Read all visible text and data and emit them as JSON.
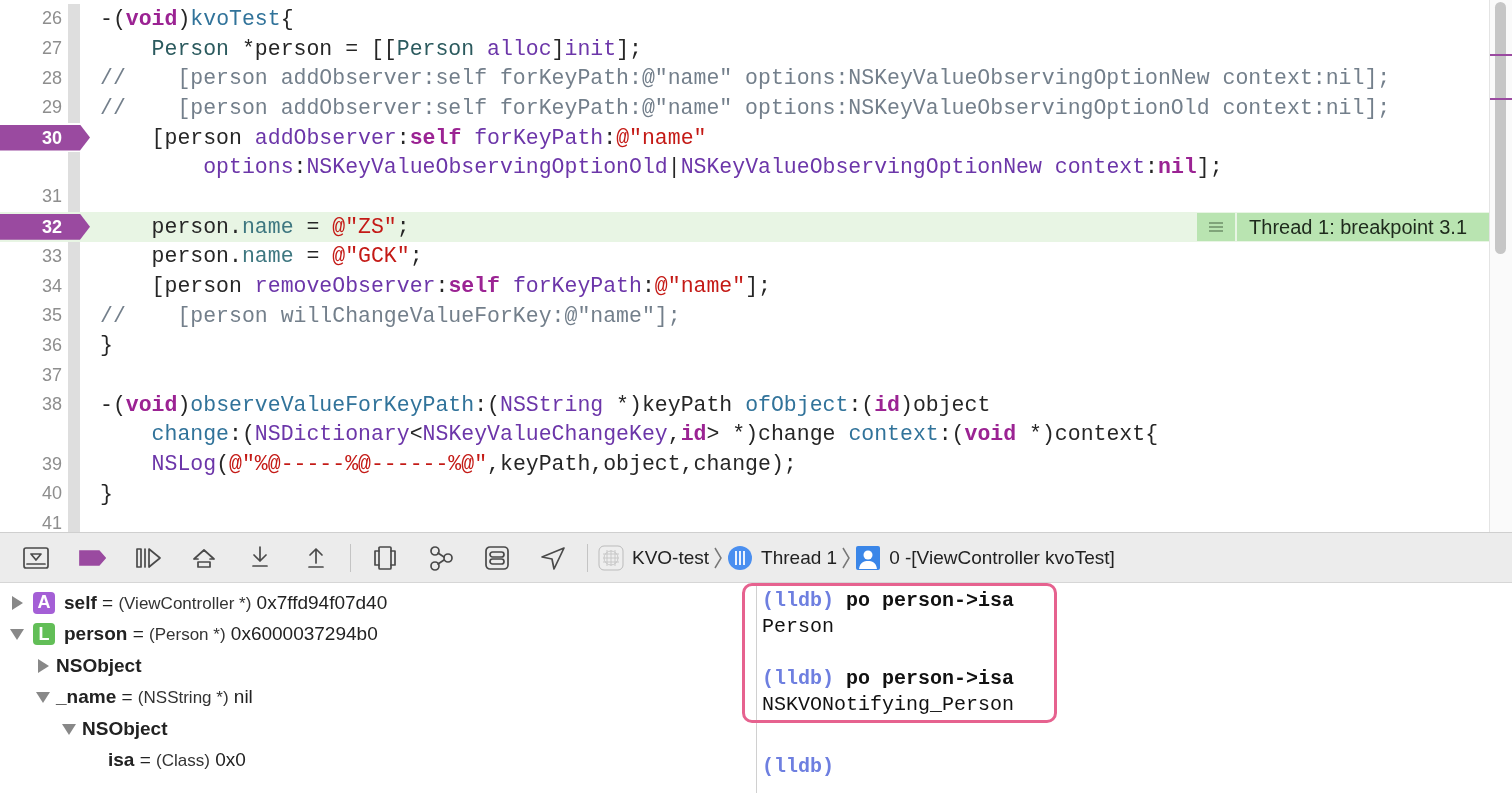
{
  "editor": {
    "lines": [
      {
        "number": "26",
        "breakpoint": false,
        "current": false,
        "segments": [
          [
            {
              "kind": "plain",
              "text": "-("
            },
            {
              "kind": "keyword",
              "text": "void"
            },
            {
              "kind": "plain",
              "text": ")"
            },
            {
              "kind": "decl",
              "text": "kvoTest"
            },
            {
              "kind": "plain",
              "text": "{"
            }
          ]
        ]
      },
      {
        "number": "27",
        "breakpoint": false,
        "current": false,
        "segments": [
          [
            {
              "kind": "type",
              "text": "    Person"
            },
            {
              "kind": "plain",
              "text": " *person = [["
            },
            {
              "kind": "type",
              "text": "Person"
            },
            {
              "kind": "api",
              "text": " alloc"
            },
            {
              "kind": "plain",
              "text": "]"
            },
            {
              "kind": "api",
              "text": "init"
            },
            {
              "kind": "plain",
              "text": "];"
            }
          ]
        ]
      },
      {
        "number": "28",
        "breakpoint": false,
        "current": false,
        "segments": [
          [
            {
              "kind": "comment",
              "text": "//    [person addObserver:self forKeyPath:@\"name\" options:NSKeyValueObservingOptionNew context:nil];"
            }
          ]
        ]
      },
      {
        "number": "29",
        "breakpoint": false,
        "current": false,
        "segments": [
          [
            {
              "kind": "comment",
              "text": "//    [person addObserver:self forKeyPath:@\"name\" options:NSKeyValueObservingOptionOld context:nil];"
            }
          ]
        ]
      },
      {
        "number": "30",
        "breakpoint": true,
        "current": false,
        "segments": [
          [
            {
              "kind": "plain",
              "text": "    [person "
            },
            {
              "kind": "api",
              "text": "addObserver"
            },
            {
              "kind": "plain",
              "text": ":"
            },
            {
              "kind": "keyword",
              "text": "self"
            },
            {
              "kind": "api",
              "text": " forKeyPath"
            },
            {
              "kind": "plain",
              "text": ":"
            },
            {
              "kind": "string",
              "text": "@\"name\""
            }
          ],
          [
            {
              "kind": "api",
              "text": "        options"
            },
            {
              "kind": "plain",
              "text": ":"
            },
            {
              "kind": "api",
              "text": "NSKeyValueObservingOptionOld"
            },
            {
              "kind": "plain",
              "text": "|"
            },
            {
              "kind": "api",
              "text": "NSKeyValueObservingOptionNew"
            },
            {
              "kind": "api",
              "text": " context"
            },
            {
              "kind": "plain",
              "text": ":"
            },
            {
              "kind": "keyword",
              "text": "nil"
            },
            {
              "kind": "plain",
              "text": "];"
            }
          ]
        ]
      },
      {
        "number": "31",
        "breakpoint": false,
        "current": false
      },
      {
        "number": "32",
        "breakpoint": true,
        "current": true,
        "annotation": "Thread 1: breakpoint 3.1",
        "segments": [
          [
            {
              "kind": "plain",
              "text": "    person."
            },
            {
              "kind": "property",
              "text": "name"
            },
            {
              "kind": "plain",
              "text": " = "
            },
            {
              "kind": "string",
              "text": "@\"ZS\""
            },
            {
              "kind": "plain",
              "text": ";"
            }
          ]
        ]
      },
      {
        "number": "33",
        "breakpoint": false,
        "current": false,
        "segments": [
          [
            {
              "kind": "plain",
              "text": "    person."
            },
            {
              "kind": "property",
              "text": "name"
            },
            {
              "kind": "plain",
              "text": " = "
            },
            {
              "kind": "string",
              "text": "@\"GCK\""
            },
            {
              "kind": "plain",
              "text": ";"
            }
          ]
        ]
      },
      {
        "number": "34",
        "breakpoint": false,
        "current": false,
        "segments": [
          [
            {
              "kind": "plain",
              "text": "    [person "
            },
            {
              "kind": "api",
              "text": "removeObserver"
            },
            {
              "kind": "plain",
              "text": ":"
            },
            {
              "kind": "keyword",
              "text": "self"
            },
            {
              "kind": "api",
              "text": " forKeyPath"
            },
            {
              "kind": "plain",
              "text": ":"
            },
            {
              "kind": "string",
              "text": "@\"name\""
            },
            {
              "kind": "plain",
              "text": "];"
            }
          ]
        ]
      },
      {
        "number": "35",
        "breakpoint": false,
        "current": false,
        "segments": [
          [
            {
              "kind": "comment",
              "text": "//    [person willChangeValueForKey:@\"name\"];"
            }
          ]
        ]
      },
      {
        "number": "36",
        "breakpoint": false,
        "current": false,
        "segments": [
          [
            {
              "kind": "plain",
              "text": "}"
            }
          ]
        ]
      },
      {
        "number": "37",
        "breakpoint": false,
        "current": false
      },
      {
        "number": "38",
        "breakpoint": false,
        "current": false,
        "segments": [
          [
            {
              "kind": "plain",
              "text": "-("
            },
            {
              "kind": "keyword",
              "text": "void"
            },
            {
              "kind": "plain",
              "text": ")"
            },
            {
              "kind": "decl",
              "text": "observeValueForKeyPath"
            },
            {
              "kind": "plain",
              "text": ":("
            },
            {
              "kind": "api",
              "text": "NSString"
            },
            {
              "kind": "plain",
              "text": " *)keyPath "
            },
            {
              "kind": "decl",
              "text": "ofObject"
            },
            {
              "kind": "plain",
              "text": ":("
            },
            {
              "kind": "keyword",
              "text": "id"
            },
            {
              "kind": "plain",
              "text": ")object"
            }
          ],
          [
            {
              "kind": "decl",
              "text": "    change"
            },
            {
              "kind": "plain",
              "text": ":("
            },
            {
              "kind": "api",
              "text": "NSDictionary"
            },
            {
              "kind": "plain",
              "text": "<"
            },
            {
              "kind": "api",
              "text": "NSKeyValueChangeKey"
            },
            {
              "kind": "plain",
              "text": ","
            },
            {
              "kind": "keyword",
              "text": "id"
            },
            {
              "kind": "plain",
              "text": "> *)change "
            },
            {
              "kind": "decl",
              "text": "context"
            },
            {
              "kind": "plain",
              "text": ":("
            },
            {
              "kind": "keyword",
              "text": "void"
            },
            {
              "kind": "plain",
              "text": " *)context{"
            }
          ]
        ]
      },
      {
        "number": "39",
        "breakpoint": false,
        "current": false,
        "segments": [
          [
            {
              "kind": "api",
              "text": "    NSLog"
            },
            {
              "kind": "plain",
              "text": "("
            },
            {
              "kind": "string",
              "text": "@\"%@-----%@------%@\""
            },
            {
              "kind": "plain",
              "text": ",keyPath,object,change);"
            }
          ]
        ]
      },
      {
        "number": "40",
        "breakpoint": false,
        "current": false,
        "segments": [
          [
            {
              "kind": "plain",
              "text": "}"
            }
          ]
        ]
      },
      {
        "number": "41",
        "breakpoint": false,
        "current": false
      }
    ]
  },
  "debug_bar": {
    "breakpoints_active": true,
    "breadcrumbs": [
      {
        "kind": "project",
        "label": "KVO-test"
      },
      {
        "kind": "thread",
        "label": "Thread 1"
      },
      {
        "kind": "frame",
        "label": "0 -[ViewController kvoTest]"
      }
    ]
  },
  "variables": [
    {
      "badge": "A",
      "color": "#a45fd6",
      "name": "self",
      "separator": "=",
      "type": "(ViewController *)",
      "value": "0x7ffd94f07d40",
      "expanded": false
    },
    {
      "badge": "L",
      "color": "#62be57",
      "name": "person",
      "separator": "=",
      "type": "(Person *)",
      "value": "0x6000037294b0",
      "expanded": true,
      "children": [
        {
          "name": "NSObject",
          "expanded": false
        },
        {
          "name": "_name",
          "separator": "=",
          "type": "(NSString *)",
          "value": "nil",
          "expanded": true,
          "children": [
            {
              "name": "NSObject",
              "expanded": true,
              "children": [
                {
                  "name": "isa",
                  "separator": "=",
                  "type": "(Class)",
                  "value": "0x0"
                }
              ]
            }
          ]
        }
      ]
    }
  ],
  "console": {
    "blocks": [
      {
        "highlighted": true,
        "lines": [
          {
            "kind": "command",
            "prompt": "(lldb)",
            "command": "po person->isa"
          },
          {
            "kind": "output",
            "text": "Person"
          },
          {
            "kind": "blank"
          },
          {
            "kind": "command",
            "prompt": "(lldb)",
            "command": "po person->isa"
          },
          {
            "kind": "output",
            "text": "NSKVONotifying_Person"
          }
        ]
      },
      {
        "highlighted": false,
        "lines": [
          {
            "kind": "blank"
          },
          {
            "kind": "command",
            "prompt": "(lldb)"
          }
        ]
      }
    ]
  }
}
